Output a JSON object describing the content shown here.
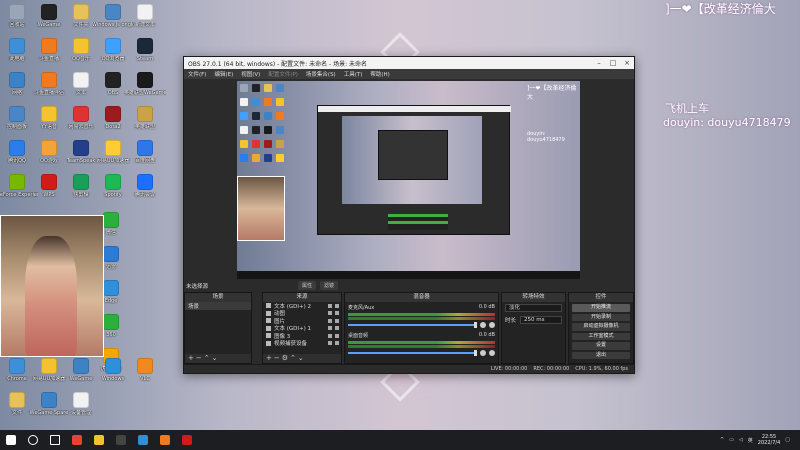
{
  "colors": {
    "obs_bg": "#2b2b2b",
    "accent_red": "#d11a1a",
    "meter_green": "#3fae43"
  },
  "overlay": {
    "top_text": "]一❤【改革经济倫大",
    "line1": "飞机上车",
    "line2": "douyin: douyu4718479"
  },
  "desktop_icons": [
    {
      "label": "回收站",
      "color": "#9aa6b8",
      "icon": "recycle-bin-icon"
    },
    {
      "label": "WeGame",
      "color": "#222",
      "icon": "wegame-icon"
    },
    {
      "label": "文件夹",
      "color": "#e7c15a",
      "icon": "folder-icon"
    },
    {
      "label": "Windows.js ongka.ini",
      "color": "#4a86c5",
      "icon": "settings-file-icon"
    },
    {
      "label": "新建文本",
      "color": "#f2f2f2",
      "icon": "text-file-icon"
    },
    {
      "label": "此电脑",
      "color": "#3f8fd8",
      "icon": "computer-icon"
    },
    {
      "label": "斗鱼直播",
      "color": "#f07a1f",
      "icon": "douyu-icon"
    },
    {
      "label": "QQ音乐",
      "color": "#f4c430",
      "icon": "qq-music-icon"
    },
    {
      "label": "QQ浏览器",
      "color": "#3fa0ff",
      "icon": "browser-icon"
    },
    {
      "label": "Steam",
      "color": "#1b2838",
      "icon": "steam-icon"
    },
    {
      "label": "网络",
      "color": "#3e82c6",
      "icon": "network-icon"
    },
    {
      "label": "斗鱼直播伴侣",
      "color": "#f07a1f",
      "icon": "douyu-companion-icon"
    },
    {
      "label": "文本",
      "color": "#f2f2f2",
      "icon": "text-file-icon"
    },
    {
      "label": "OBS",
      "color": "#222",
      "icon": "obs-icon"
    },
    {
      "label": "英雄联盟WeGame版",
      "color": "#1a1a1a",
      "icon": "lol-icon"
    },
    {
      "label": "控制面板",
      "color": "#4a86c5",
      "icon": "control-panel-icon"
    },
    {
      "label": "YY语音",
      "color": "#f4c430",
      "icon": "yy-icon"
    },
    {
      "label": "网易云音乐",
      "color": "#d33",
      "icon": "netease-music-icon"
    },
    {
      "label": "Dota2",
      "color": "#9b1c1c",
      "icon": "dota-icon"
    },
    {
      "label": "英雄联盟",
      "color": "#caa24a",
      "icon": "lol-client-icon"
    },
    {
      "label": "腾讯QQ",
      "color": "#2b7de9",
      "icon": "qq-icon"
    },
    {
      "label": "QQ游戏",
      "color": "#f2a33a",
      "icon": "qq-game-icon"
    },
    {
      "label": "TeamSpeak",
      "color": "#233f8c",
      "icon": "teamspeak-icon"
    },
    {
      "label": "网易UU加速器",
      "color": "#ffcc33",
      "icon": "uu-icon"
    },
    {
      "label": "百度网盘",
      "color": "#2e77e8",
      "icon": "baidu-disk-icon"
    },
    {
      "label": "GeForce Experience",
      "color": "#76b900",
      "icon": "geforce-icon"
    },
    {
      "label": "WPS",
      "color": "#d11a1a",
      "icon": "wps-icon"
    },
    {
      "label": "快剪辑",
      "color": "#1b9e5a",
      "icon": "video-edit-icon"
    },
    {
      "label": "Spotify",
      "color": "#1db954",
      "icon": "spotify-icon"
    },
    {
      "label": "腾讯会议",
      "color": "#1e6fff",
      "icon": "meeting-icon"
    }
  ],
  "desktop_icons_right_col": [
    {
      "label": "微信",
      "color": "#2ab13c",
      "icon": "wechat-icon"
    },
    {
      "label": "迅雷",
      "color": "#2e7bd6",
      "icon": "xunlei-icon"
    },
    {
      "label": "Edge",
      "color": "#2f8fd8",
      "icon": "edge-icon"
    },
    {
      "label": "360",
      "color": "#2ab13c",
      "icon": "360-icon"
    },
    {
      "label": "虎牙直播",
      "color": "#f4a600",
      "icon": "huya-icon"
    }
  ],
  "desktop_icons_bottom": [
    {
      "label": "Chrome",
      "color": "#3f8fd8",
      "icon": "chrome-icon"
    },
    {
      "label": "网易UU加速器",
      "color": "#f2c230",
      "icon": "uu-accelerator-icon"
    },
    {
      "label": "WeGame",
      "color": "#3e82c6",
      "icon": "wegame-2-icon"
    },
    {
      "label": "Windows",
      "color": "#2f8fd8",
      "icon": "windows-icon"
    },
    {
      "label": "VLC",
      "color": "#f08a1e",
      "icon": "vlc-icon"
    },
    {
      "label": "文件",
      "color": "#e7c15a",
      "icon": "folder-2-icon"
    },
    {
      "label": "WeGame Spare",
      "color": "#3e82c6",
      "icon": "wegame-spare-icon"
    },
    {
      "label": "设备管理",
      "color": "#f2f2f2",
      "icon": "device-icon"
    }
  ],
  "obs": {
    "title": "OBS 27.0.1 (64 bit, windows) - 配置文件: 未命名 - 场景: 未命名",
    "menu": [
      "文件(F)",
      "编辑(E)",
      "视图(V)",
      "配置文件(P)",
      "场景集合(S)",
      "工具(T)",
      "帮助(H)"
    ],
    "scene_status": "未选择源",
    "controls_row": [
      "属性",
      "滤镜"
    ],
    "docks": {
      "scenes": {
        "title": "场景",
        "items": [
          "场景"
        ]
      },
      "sources": {
        "title": "来源",
        "items": [
          "文本 (GDI+) 2",
          "动图",
          "图片",
          "文本 (GDI+) 1",
          "图像 3",
          "视频捕获设备"
        ]
      },
      "mixer": {
        "title": "混音器",
        "channels": [
          {
            "name": "麦克风/Aux",
            "db": "0.0 dB"
          },
          {
            "name": "桌面音频",
            "db": "0.0 dB"
          }
        ]
      },
      "transitions": {
        "title": "转场特效",
        "mode": "淡化",
        "duration_label": "时长",
        "duration": "250 ms"
      },
      "controls": {
        "title": "控件",
        "buttons": [
          "开始推流",
          "开始录制",
          "启动虚拟摄像机",
          "工作室模式",
          "设置",
          "退出"
        ]
      }
    },
    "status_bar": [
      "LIVE: 00:00:00",
      "REC: 00:00:00",
      "CPU: 1.9%, 60.00 fps"
    ]
  },
  "taskbar": {
    "icons": [
      "windows-start-icon",
      "search-icon",
      "task-view-icon",
      "chrome-icon",
      "explorer-icon",
      "obs-icon",
      "edge-icon",
      "douyu-icon",
      "netease-icon"
    ],
    "colors": [
      "#ffffff",
      "#ffffff",
      "#ffffff",
      "#e94235",
      "#f2c230",
      "#444",
      "#2f8fd8",
      "#f07a1f",
      "#d11a1a"
    ],
    "time": "22:55",
    "date": "2022/7/4",
    "ime": "英"
  }
}
